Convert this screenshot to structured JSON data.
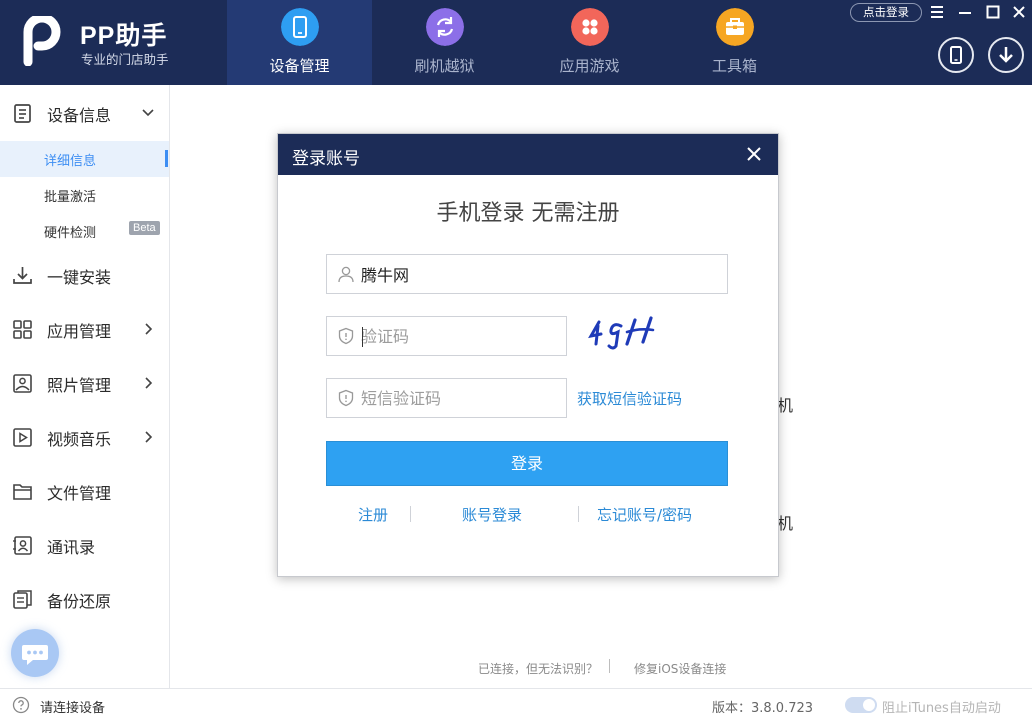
{
  "brand": {
    "title": "PP助手",
    "subtitle": "专业的门店助手"
  },
  "nav": {
    "tabs": [
      {
        "label": "设备管理",
        "color": "#2e9ef2",
        "active": true
      },
      {
        "label": "刷机越狱",
        "color": "#8c6fe8",
        "active": false
      },
      {
        "label": "应用游戏",
        "color": "#f2665a",
        "active": false
      },
      {
        "label": "工具箱",
        "color": "#f6a623",
        "active": false
      }
    ]
  },
  "topbar": {
    "login_label": "点击登录"
  },
  "sidebar": {
    "device_info": "设备信息",
    "sub_items": [
      "详细信息",
      "批量激活",
      "硬件检测"
    ],
    "beta_badge": "Beta",
    "items": [
      "一键安装",
      "应用管理",
      "照片管理",
      "视频音乐",
      "文件管理",
      "通讯录",
      "备份还原"
    ]
  },
  "main": {
    "bg_fragment_1": "机",
    "bg_fragment_2": "机",
    "hint_unrecognized": "已连接，但无法识别？",
    "hint_repair": "修复iOS设备连接"
  },
  "statusbar": {
    "status": "请连接设备",
    "version": "版本：3.8.0.723",
    "toggle_label": "阻止iTunes自动启动"
  },
  "dialog": {
    "title": "登录账号",
    "heading": "手机登录 无需注册",
    "phone_value": "腾牛网",
    "captcha_placeholder": "验证码",
    "sms_placeholder": "短信验证码",
    "sms_link": "获取短信验证码",
    "login_button": "登录",
    "register_link": "注册",
    "account_login_link": "账号登录",
    "forgot_link": "忘记账号/密码"
  },
  "colors": {
    "header_bg": "#1c2c57",
    "accent": "#2ea1f2",
    "link": "#2b8ad6"
  }
}
